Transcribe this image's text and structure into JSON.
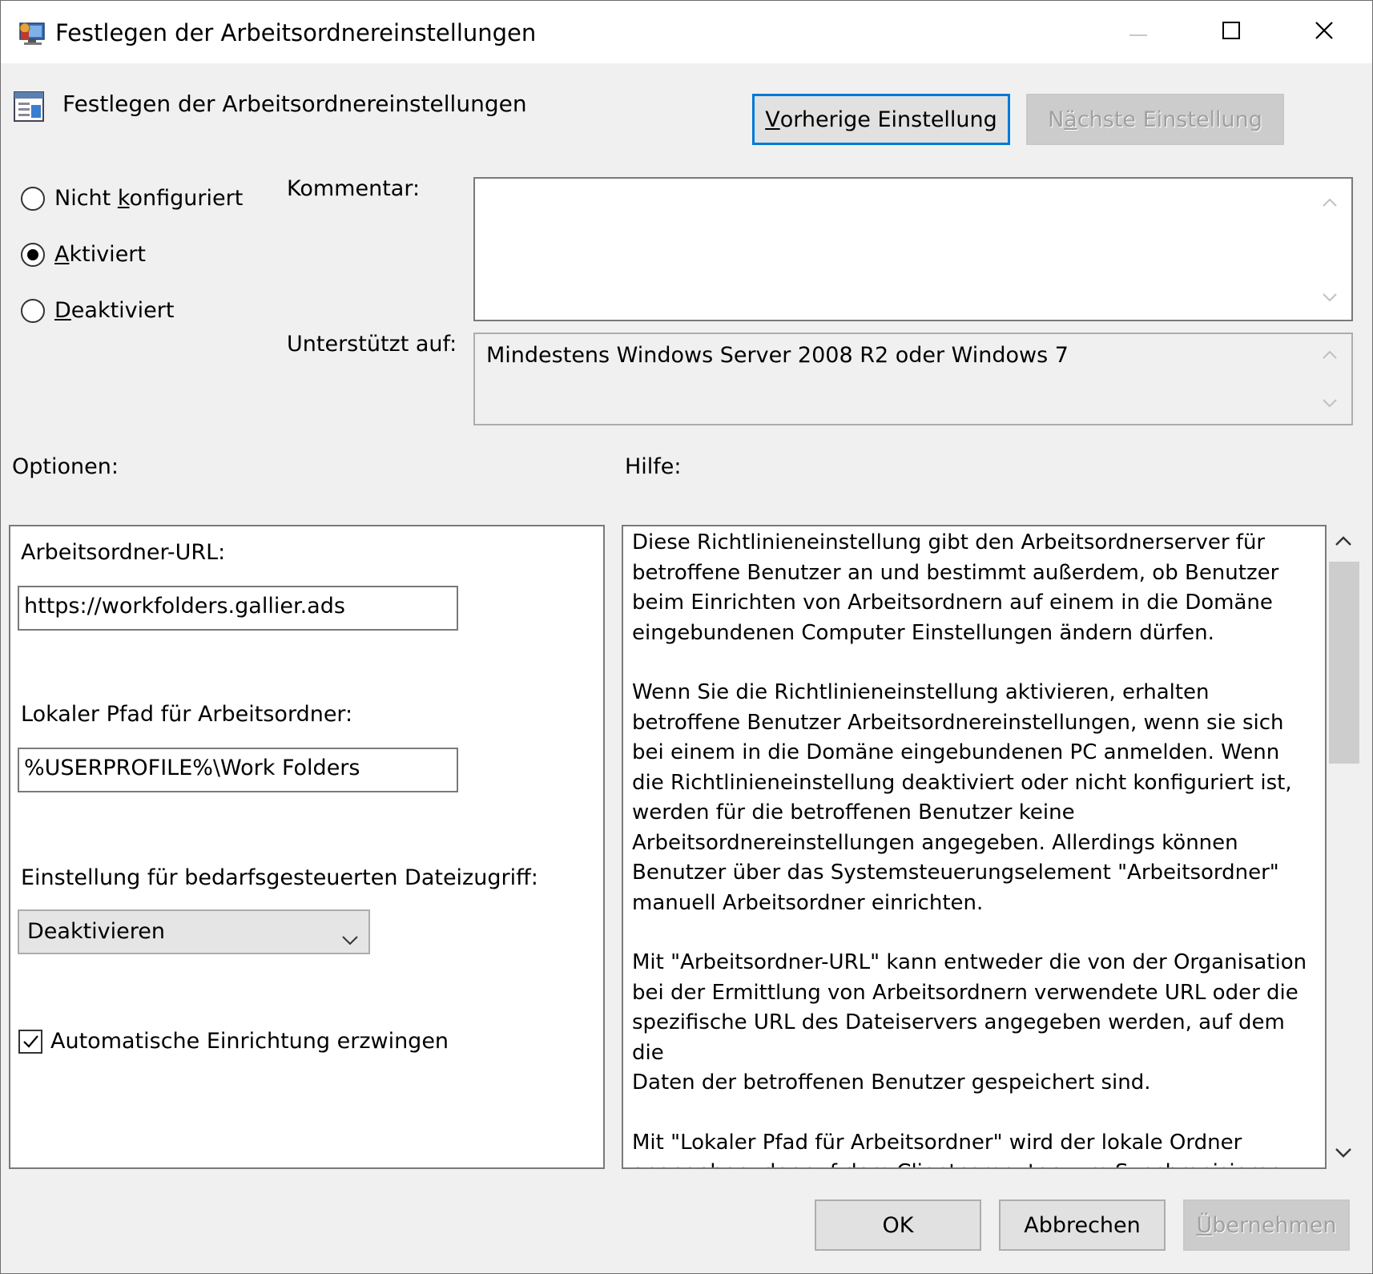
{
  "window": {
    "title": "Festlegen der Arbeitsordnereinstellungen"
  },
  "header": {
    "policy_title": "Festlegen der Arbeitsordnereinstellungen",
    "prev_button": {
      "accel": "V",
      "rest": "orherige Einstellung"
    },
    "next_button": {
      "pre": "N",
      "accel": "ä",
      "rest": "chste Einstellung"
    }
  },
  "state": {
    "not_configured": {
      "pre": "Nicht ",
      "accel": "k",
      "rest": "onfiguriert"
    },
    "enabled": {
      "accel": "A",
      "rest": "ktiviert"
    },
    "disabled": {
      "accel": "D",
      "rest": "eaktiviert"
    },
    "selected": "enabled"
  },
  "comment": {
    "label": "Kommentar:",
    "value": ""
  },
  "supported": {
    "label": "Unterstützt auf:",
    "value": "Mindestens Windows Server 2008 R2 oder Windows 7"
  },
  "options": {
    "label": "Optionen:",
    "url_label": "Arbeitsordner-URL:",
    "url_value": "https://workfolders.gallier.ads",
    "path_label": "Lokaler Pfad für Arbeitsordner:",
    "path_value": "%USERPROFILE%\\Work Folders",
    "ondemand_label": "Einstellung für bedarfsgesteuerten Dateizugriff:",
    "ondemand_value": "Deaktivieren",
    "force_label": "Automatische Einrichtung erzwingen",
    "force_checked": true
  },
  "help": {
    "label": "Hilfe:",
    "paragraphs": [
      "Diese Richtlinieneinstellung gibt den Arbeitsordnerserver für\nbetroffene Benutzer an und bestimmt außerdem, ob Benutzer\nbeim Einrichten von Arbeitsordnern auf einem in die Domäne\neingebundenen Computer Einstellungen ändern dürfen.",
      "Wenn Sie die Richtlinieneinstellung aktivieren, erhalten\nbetroffene Benutzer Arbeitsordnereinstellungen, wenn sie sich\nbei einem in die Domäne eingebundenen PC anmelden. Wenn\ndie Richtlinieneinstellung deaktiviert oder nicht konfiguriert ist,\nwerden für die betroffenen Benutzer keine\nArbeitsordnereinstellungen angegeben. Allerdings können\nBenutzer über das Systemsteuerungselement \"Arbeitsordner\"\nmanuell Arbeitsordner einrichten.",
      "Mit \"Arbeitsordner-URL\" kann entweder die von der Organisation\nbei der Ermittlung von Arbeitsordnern verwendete URL oder die\nspezifische URL des Dateiservers angegeben werden, auf dem die\nDaten der betroffenen Benutzer gespeichert sind.",
      "Mit \"Lokaler Pfad für Arbeitsordner\" wird der lokale Ordner\nangegeben, der auf dem Clientcomputer zum Synchronisieren"
    ]
  },
  "footer": {
    "ok": "OK",
    "cancel": "Abbrechen",
    "apply": {
      "accel": "Ü",
      "rest": "bernehmen"
    }
  },
  "colors": {
    "focus_border": "#0078d7",
    "dialog_bg": "#f0f0f0"
  }
}
